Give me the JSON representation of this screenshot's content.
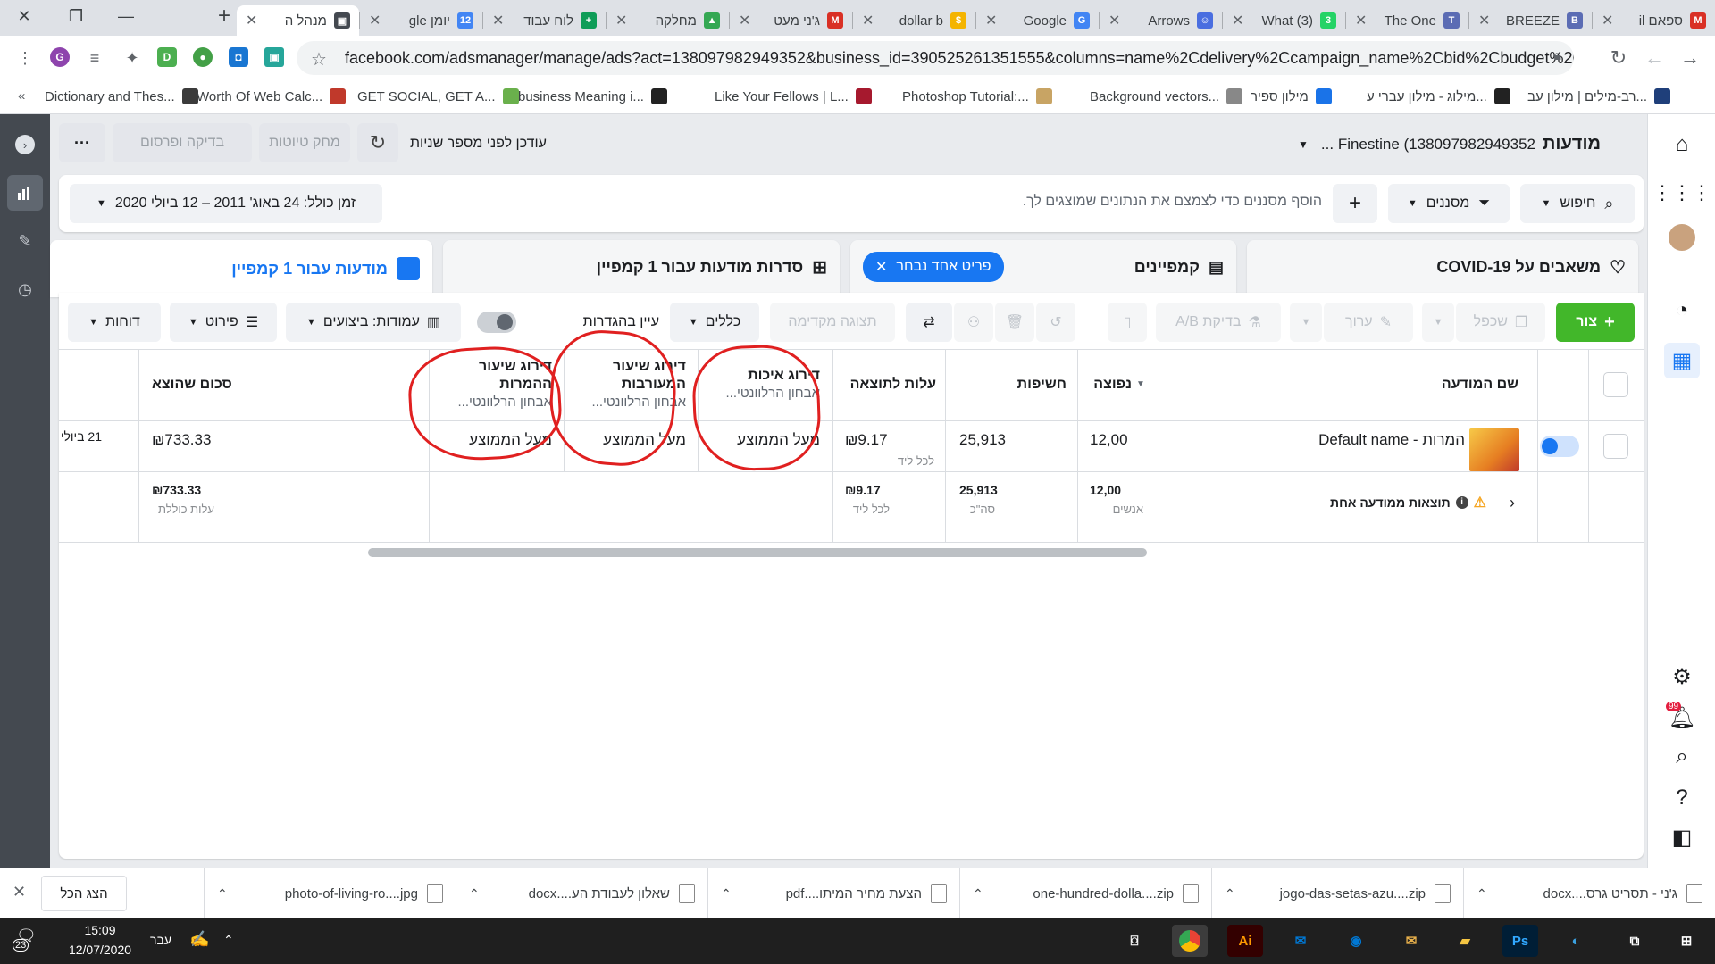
{
  "browser": {
    "tabs": [
      {
        "title": "ספאם il",
        "icon": "gmail-icon",
        "color": "#d93025",
        "glyph": "M"
      },
      {
        "title": "BREEZE",
        "icon": "site-icon",
        "color": "#5b6cb4",
        "glyph": "B"
      },
      {
        "title": "The One",
        "icon": "site-icon",
        "color": "#5b6cb4",
        "glyph": "T"
      },
      {
        "title": "(3) What",
        "icon": "whatsapp-icon",
        "color": "#25d366",
        "glyph": "3"
      },
      {
        "title": "Arrows",
        "icon": "reddit-icon",
        "color": "#4a6ee0",
        "glyph": "☺"
      },
      {
        "title": "Google",
        "icon": "translate-icon",
        "color": "#4285f4",
        "glyph": "G"
      },
      {
        "title": "dollar b",
        "icon": "s-icon",
        "color": "#f4b400",
        "glyph": "$"
      },
      {
        "title": "ג'ני מעט",
        "icon": "gmail-icon",
        "color": "#d93025",
        "glyph": "M"
      },
      {
        "title": "מחלקה",
        "icon": "drive-icon",
        "color": "#34a853",
        "glyph": "▲"
      },
      {
        "title": "לוח עבוד",
        "icon": "sheets-icon",
        "color": "#0f9d58",
        "glyph": "+"
      },
      {
        "title": "יומן gle",
        "icon": "calendar-icon",
        "color": "#4285f4",
        "glyph": "12"
      },
      {
        "title": "מנהל ה",
        "icon": "ads-icon",
        "color": "#444950",
        "glyph": "▣"
      }
    ],
    "new_tab": "+",
    "url": "facebook.com/adsmanager/manage/ads?act=138097982949352&business_id=390525261351555&columns=name%2Cdelivery%2Ccampaign_name%2Cbid%2Cbudget%2Cla...",
    "bookmarks": [
      {
        "label": "Dictionary and Thes...",
        "icon": "dictionary-icon",
        "color": "#3b3b3b"
      },
      {
        "label": "Worth Of Web Calc...",
        "icon": "wow-icon",
        "color": "#c0392b"
      },
      {
        "label": "GET SOCIAL, GET A...",
        "icon": "getsocial-icon",
        "color": "#6ab04c"
      },
      {
        "label": "business Meaning i...",
        "icon": "gc-icon",
        "color": "#222222"
      },
      {
        "label": "Like Your Fellows | L...",
        "icon": "cambridge-icon",
        "color": "#a6192e"
      },
      {
        "label": "Photoshop Tutorial:...",
        "icon": "photoshop-icon",
        "color": "#c8a464"
      },
      {
        "label": "Background vectors...",
        "icon": "freepik-icon",
        "color": "#888888"
      },
      {
        "label": "מילון ספיר",
        "icon": "sapir-icon",
        "color": "#1a73e8"
      },
      {
        "label": "מילוג - מילון עברי ע...",
        "icon": "milog-icon",
        "color": "#222222"
      },
      {
        "label": "רב-מילים | מילון עב...",
        "icon": "ravmilim-icon",
        "color": "#1f3f7a"
      }
    ]
  },
  "header": {
    "title": "מודעות",
    "account": "Finestine (138097982949352 ...",
    "status": "עודכן לפני מספר שניות",
    "discard": "מחק טיוטות",
    "review": "בדיקה ופרסום",
    "more": "···"
  },
  "filter": {
    "search": "חיפוש",
    "filters": "מסננים",
    "placeholder": "הוסף מסננים כדי לצמצם את הנתונים שמוצגים לך.",
    "date": "זמן כולל: 24 באוג' 2011 – 12 ביולי 2020"
  },
  "level_tabs": {
    "covid": "משאבים על COVID-19",
    "campaigns": "קמפיינים",
    "chip": "פריט אחד נבחר",
    "adsets": "סדרות מודעות עבור 1 קמפיין",
    "ads": "מודעות עבור 1 קמפיין"
  },
  "toolbar": {
    "create": "צור",
    "duplicate": "שכפל",
    "edit": "ערוך",
    "ab_test": "בדיקת A/B",
    "preview": "תצוגה מקדימה",
    "rules": "כללים",
    "view_settings": "עיין בהגדרות",
    "columns": "עמודות: ביצועים",
    "breakdown": "פירוט",
    "reports": "דוחות"
  },
  "table": {
    "headers": {
      "name": "שם המודעה",
      "reach": "נפוצה",
      "impressions": "חשיפות",
      "cpr": "עלות לתוצאה",
      "quality": "דירוג איכות",
      "quality_sub": "אבחון הרלוונטי...",
      "engagement": "דירוג שיעור המעורבות",
      "engagement_sub": "אבחון הרלוונטי...",
      "conversion": "דירוג שיעור ההמרות",
      "conversion_sub": "אבחון הרלוונטי...",
      "spent": "סכום שהוצא"
    },
    "row": {
      "name": "המרות - Default name",
      "reach": "12,00",
      "impressions": "25,913",
      "cpr": "₪9.17",
      "cpr_sub": "לכל ליד",
      "quality": "מעל הממוצע",
      "engagement": "מעל הממוצע",
      "conversion": "מעל הממוצע",
      "spent": "₪733.33",
      "ends": "21 ביולי"
    },
    "summary": {
      "label": "תוצאות ממודעה אחת",
      "reach": "12,00",
      "reach_sub": "אנשים",
      "impressions": "25,913",
      "impressions_sub": "סה\"כ",
      "cpr": "₪9.17",
      "cpr_sub": "לכל ליד",
      "spent": "₪733.33",
      "spent_sub": "עלות כוללת"
    }
  },
  "right_rail": {
    "notifications_badge": "99"
  },
  "downloads": {
    "items": [
      {
        "name": "ג'ני - תסריט גרס....docx",
        "type": "docx"
      },
      {
        "name": "jogo-das-setas-azu....zip",
        "type": "zip"
      },
      {
        "name": "one-hundred-dolla....zip",
        "type": "zip"
      },
      {
        "name": "הצעת מחיר המיתו....pdf",
        "type": "pdf"
      },
      {
        "name": "שאלון לעבודת הע....docx",
        "type": "docx"
      },
      {
        "name": "photo-of-living-ro....jpg",
        "type": "jpg"
      }
    ],
    "show_all": "הצג הכל"
  },
  "taskbar": {
    "time": "15:09",
    "date": "12/07/2020",
    "lang": "עבר",
    "notif_count": "23"
  },
  "colors": {
    "accent": "#1877f2",
    "create_green": "#42b72a",
    "annotation_red": "#e02020"
  }
}
